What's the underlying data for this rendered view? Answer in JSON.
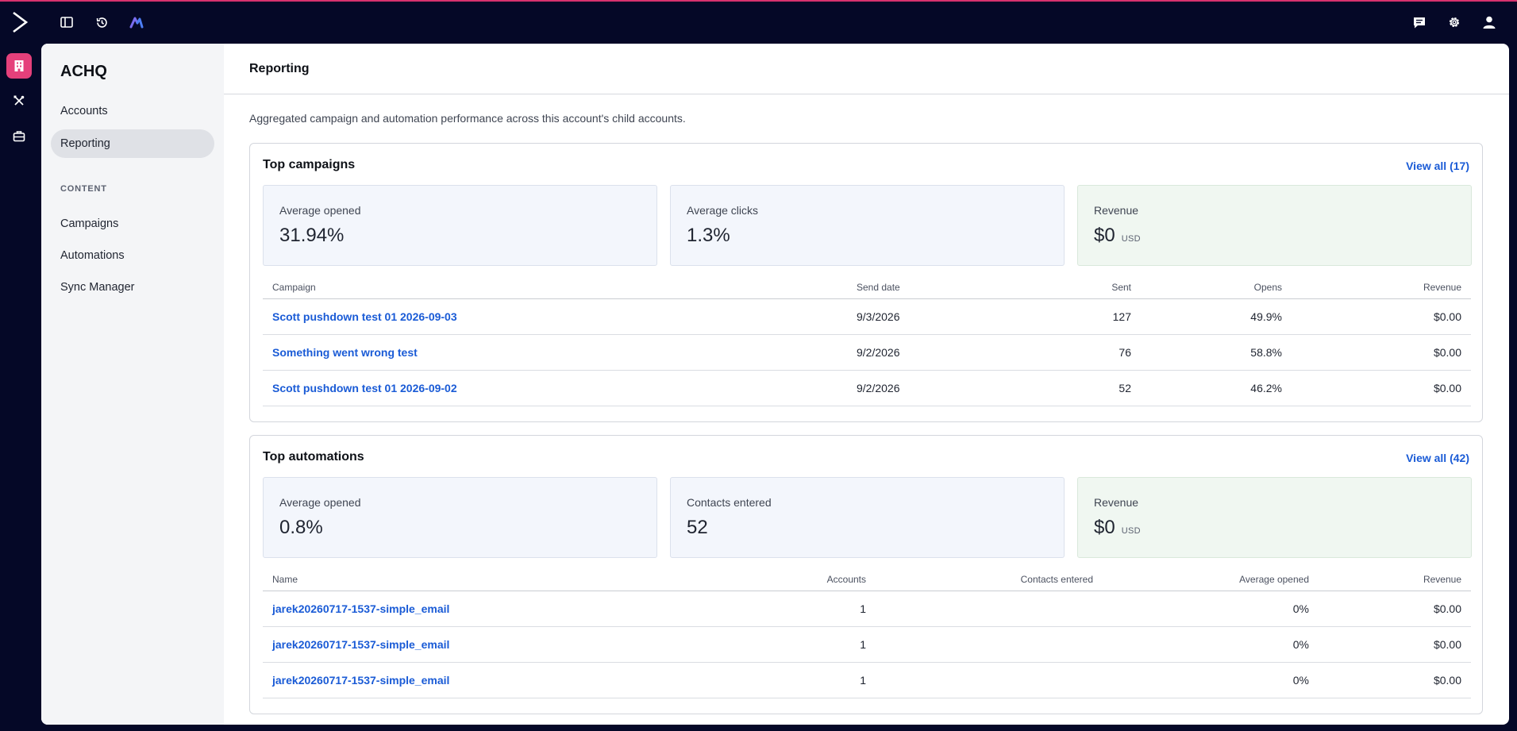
{
  "app": {
    "logo_icon": "activecampaign-chevron-icon",
    "accent_color": "#e5407b",
    "topbar_icons": [
      "sidebar-toggle-icon",
      "history-icon",
      "apps-logo-icon",
      "chat-icon",
      "gear-icon",
      "user-icon"
    ],
    "rail_icons": [
      "building-icon",
      "tools-icon",
      "briefcase-icon"
    ]
  },
  "sidenav": {
    "title": "ACHQ",
    "items": [
      {
        "label": "Accounts",
        "active": false
      },
      {
        "label": "Reporting",
        "active": true
      }
    ],
    "section_label": "CONTENT",
    "content_items": [
      {
        "label": "Campaigns"
      },
      {
        "label": "Automations"
      },
      {
        "label": "Sync Manager"
      }
    ]
  },
  "page": {
    "title": "Reporting",
    "description": "Aggregated campaign and automation performance across this account's child accounts."
  },
  "campaigns": {
    "title": "Top campaigns",
    "view_all": "View all (17)",
    "stats": [
      {
        "label": "Average opened",
        "value": "31.94%",
        "unit": ""
      },
      {
        "label": "Average clicks",
        "value": "1.3%",
        "unit": ""
      },
      {
        "label": "Revenue",
        "value": "$0",
        "unit": "USD"
      }
    ],
    "columns": [
      "Campaign",
      "Send date",
      "Sent",
      "Opens",
      "Revenue"
    ],
    "rows": [
      [
        "Scott pushdown test 01 2026-09-03",
        "9/3/2026",
        "127",
        "49.9%",
        "$0.00"
      ],
      [
        "Something went wrong test",
        "9/2/2026",
        "76",
        "58.8%",
        "$0.00"
      ],
      [
        "Scott pushdown test 01 2026-09-02",
        "9/2/2026",
        "52",
        "46.2%",
        "$0.00"
      ]
    ]
  },
  "automations": {
    "title": "Top automations",
    "view_all": "View all (42)",
    "stats": [
      {
        "label": "Average opened",
        "value": "0.8%",
        "unit": ""
      },
      {
        "label": "Contacts entered",
        "value": "52",
        "unit": ""
      },
      {
        "label": "Revenue",
        "value": "$0",
        "unit": "USD"
      }
    ],
    "columns": [
      "Name",
      "Accounts",
      "Contacts entered",
      "Average opened",
      "Revenue"
    ],
    "rows": [
      [
        "jarek20260717-1537-simple_email",
        "1",
        "",
        "0%",
        "$0.00"
      ],
      [
        "jarek20260717-1537-simple_email",
        "1",
        "",
        "0%",
        "$0.00"
      ],
      [
        "jarek20260717-1537-simple_email",
        "1",
        "",
        "0%",
        "$0.00"
      ]
    ]
  }
}
